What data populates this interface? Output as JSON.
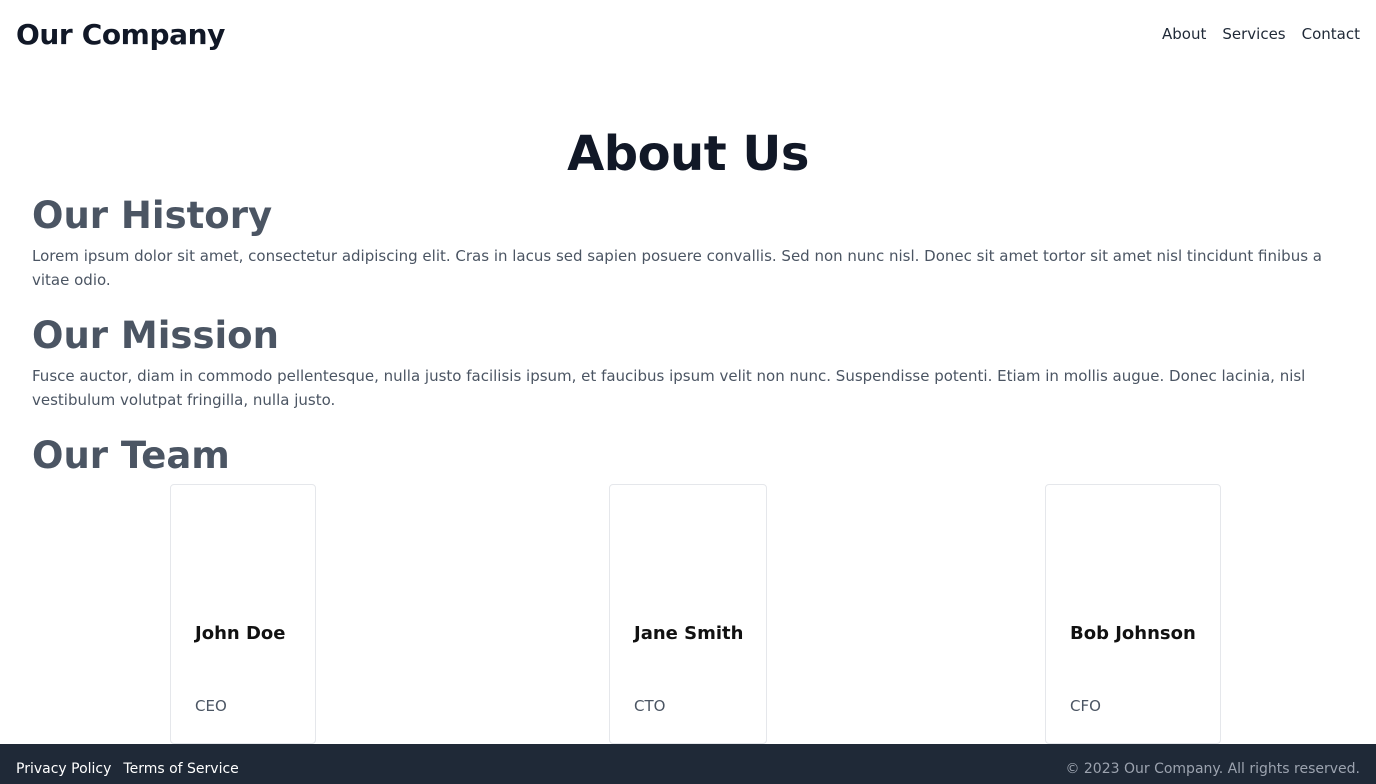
{
  "header": {
    "brand": "Our Company",
    "nav": [
      {
        "label": "About"
      },
      {
        "label": "Services"
      },
      {
        "label": "Contact"
      }
    ]
  },
  "page": {
    "title": "About Us"
  },
  "sections": {
    "history": {
      "heading": "Our History",
      "text": "Lorem ipsum dolor sit amet, consectetur adipiscing elit. Cras in lacus sed sapien posuere convallis. Sed non nunc nisl. Donec sit amet tortor sit amet nisl tincidunt finibus a vitae odio."
    },
    "mission": {
      "heading": "Our Mission",
      "text": "Fusce auctor, diam in commodo pellentesque, nulla justo facilisis ipsum, et faucibus ipsum velit non nunc. Suspendisse potenti. Etiam in mollis augue. Donec lacinia, nisl vestibulum volutpat fringilla, nulla justo."
    },
    "team": {
      "heading": "Our Team",
      "members": [
        {
          "name": "John Doe",
          "role": "CEO"
        },
        {
          "name": "Jane Smith",
          "role": "CTO"
        },
        {
          "name": "Bob Johnson",
          "role": "CFO"
        }
      ]
    }
  },
  "footer": {
    "links": [
      {
        "label": "Privacy Policy"
      },
      {
        "label": "Terms of Service"
      }
    ],
    "copyright": "© 2023 Our Company. All rights reserved."
  },
  "colors": {
    "heading": "#111827",
    "section_heading": "#4b5563",
    "body_text": "#4b5563",
    "footer_bg": "#1f2937"
  }
}
